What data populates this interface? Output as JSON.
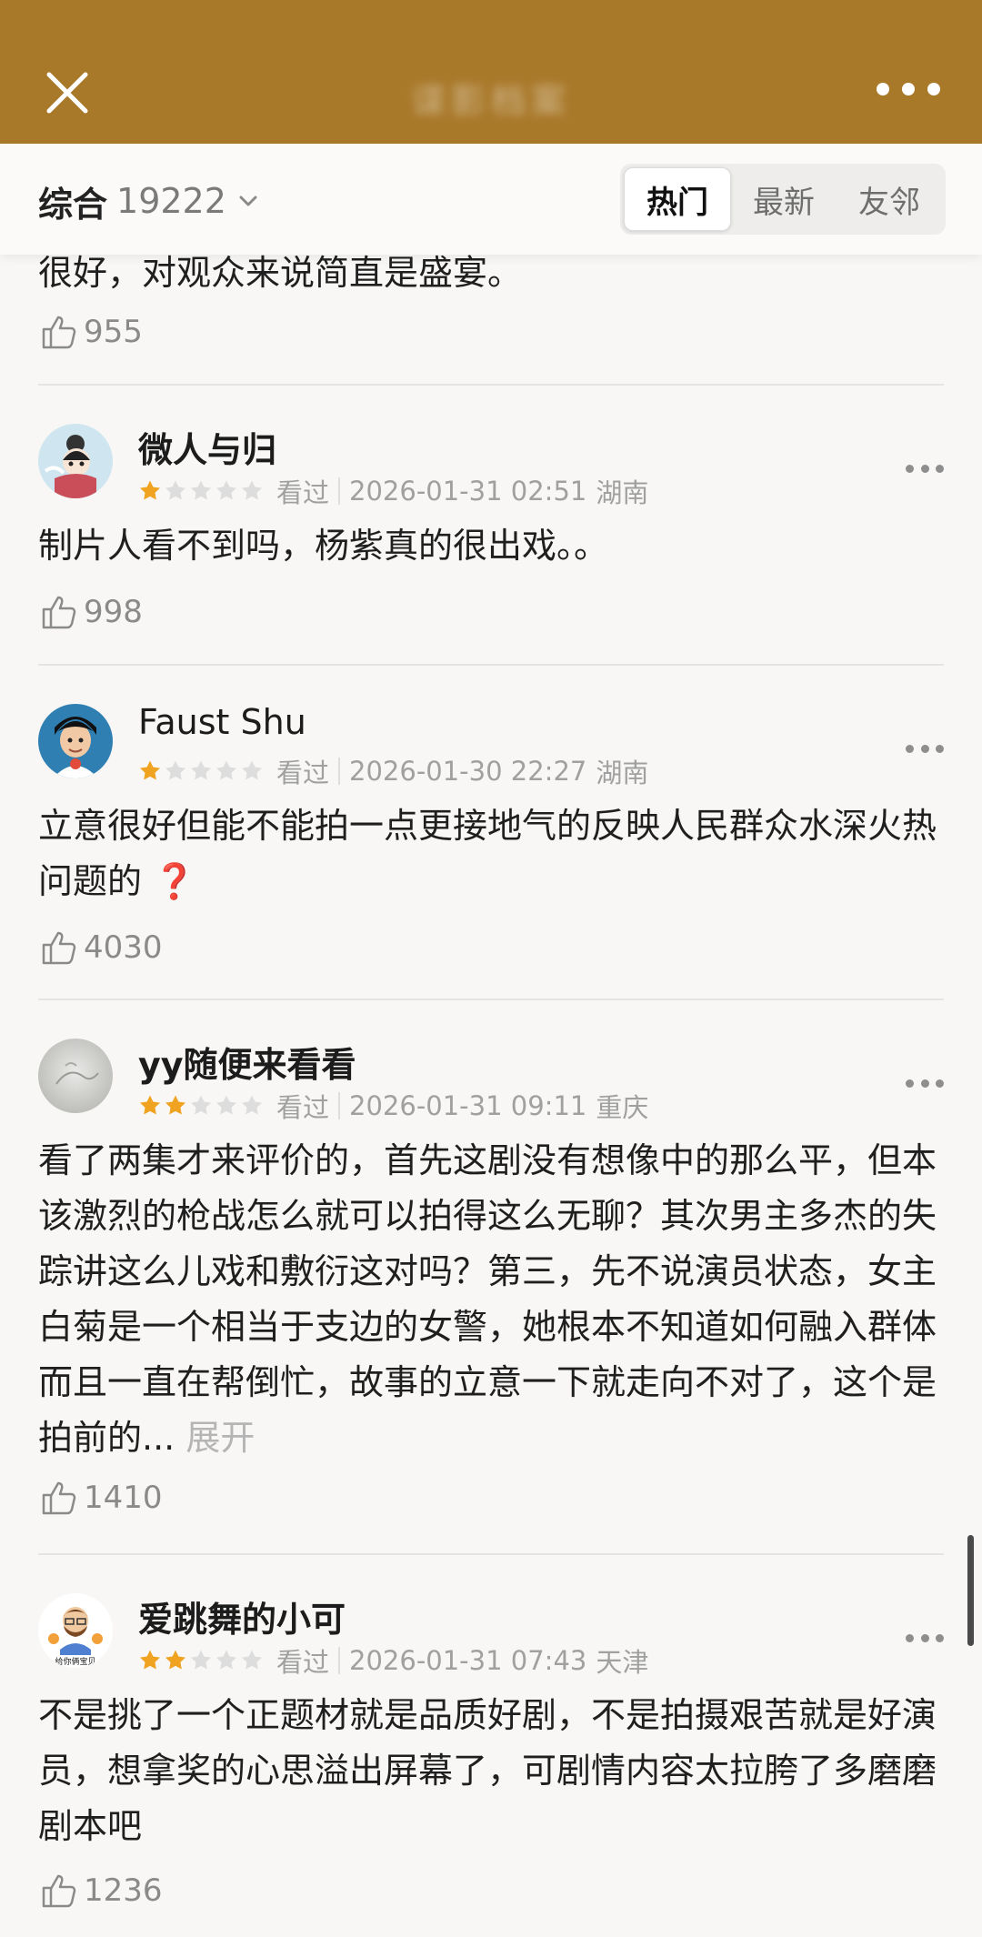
{
  "header": {
    "title": "谍影档案",
    "close_icon": "close-icon",
    "more_icon": "more-horizontal-icon",
    "bar_color": "#a9792a"
  },
  "filter": {
    "sort_label": "综合",
    "sort_count": "19222",
    "tabs": [
      {
        "label": "热门",
        "active": true
      },
      {
        "label": "最新",
        "active": false
      },
      {
        "label": "友邻",
        "active": false
      }
    ]
  },
  "fragment": {
    "text": "很好，对观众来说简直是盛宴。",
    "likes": "955"
  },
  "reviews": [
    {
      "username": "微人与归",
      "rating": 1,
      "status": "看过",
      "datetime": "2026-01-31 02:51",
      "location": "湖南",
      "text": "制片人看不到吗，杨紫真的很出戏。。",
      "likes": "998"
    },
    {
      "username": "Faust Shu",
      "rating": 1,
      "status": "看过",
      "datetime": "2026-01-30 22:27",
      "location": "湖南",
      "text": "立意很好但能不能拍一点更接地气的反映人民群众水深火热问题的 ",
      "emoji": "❓",
      "likes": "4030"
    },
    {
      "username": "yy随便来看看",
      "rating": 2,
      "status": "看过",
      "datetime": "2026-01-31 09:11",
      "location": "重庆",
      "text": "看了两集才来评价的，首先这剧没有想像中的那么平，但本该激烈的枪战怎么就可以拍得这么无聊？其次男主多杰的失踪讲这么儿戏和敷衍这对吗？第三，先不说演员状态，女主白菊是一个相当于支边的女警，她根本不知道如何融入群体而且一直在帮倒忙，故事的立意一下就走向不对了，这个是拍前的...",
      "expand_label": " 展开",
      "likes": "1410"
    },
    {
      "username": "爱跳舞的小可",
      "rating": 2,
      "status": "看过",
      "datetime": "2026-01-31 07:43",
      "location": "天津",
      "text": "不是挑了一个正题材就是品质好剧，不是拍摄艰苦就是好演员，想拿奖的心思溢出屏幕了，可剧情内容太拉胯了多磨磨剧本吧",
      "likes": "1236"
    }
  ],
  "colors": {
    "star_filled": "#f0a321",
    "star_empty": "#dddddd"
  }
}
